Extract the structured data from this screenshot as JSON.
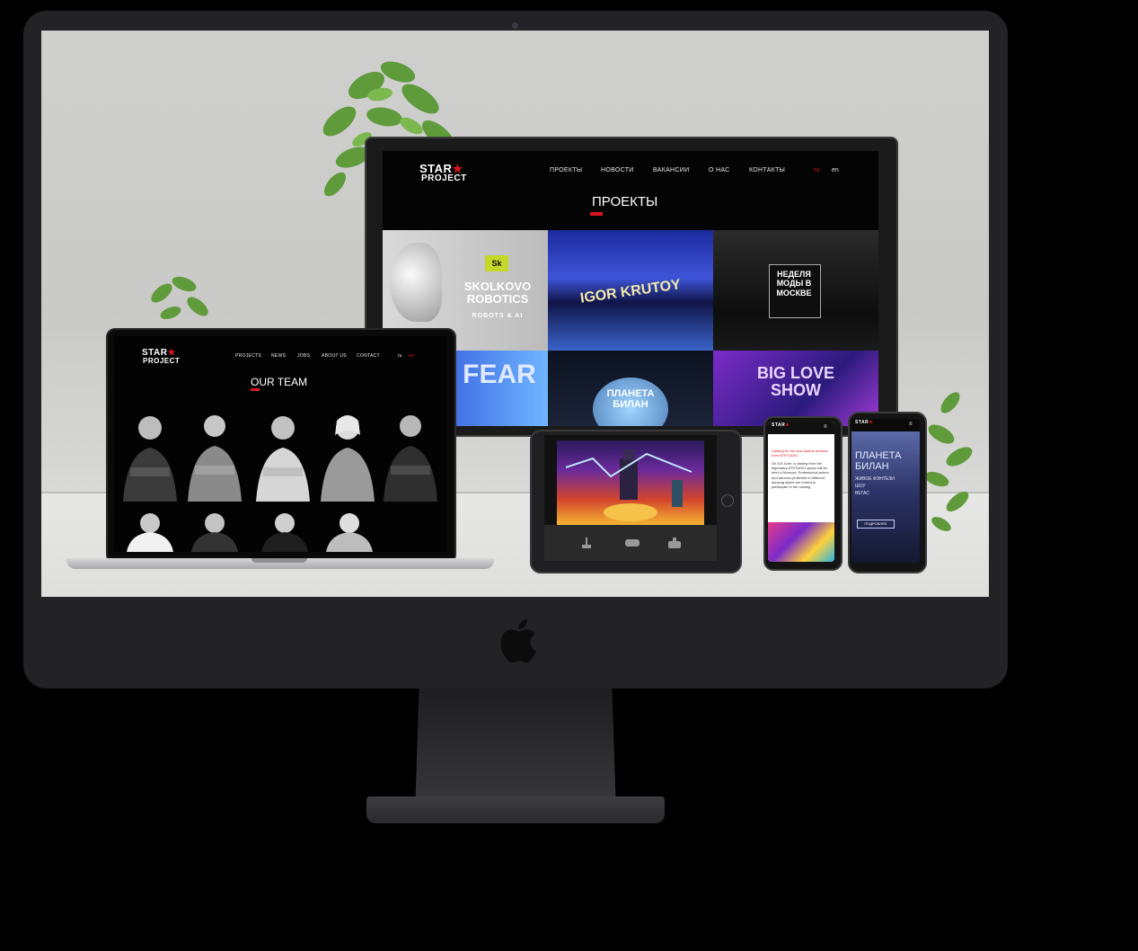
{
  "monitor": {
    "logo_line1": "STAR",
    "logo_line2": "PROJECT",
    "nav": [
      "ПРОЕКТЫ",
      "НОВОСТИ",
      "ВАКАНСИИ",
      "О НАС",
      "КОНТАКТЫ"
    ],
    "lang_ru": "ru",
    "lang_en": "en",
    "page_title": "ПРОЕКТЫ",
    "tiles": [
      {
        "text": "SKOLKOVO ROBOTICS",
        "sub": "ROBOTS & AI",
        "badge": "Sk"
      },
      {
        "text": "IGOR KRUTOY",
        "sub": ""
      },
      {
        "text": "НЕДЕЛЯ МОДЫ В МОСКВЕ",
        "sub": ""
      },
      {
        "text": "FEAR",
        "sub": ""
      },
      {
        "text": "ПЛАНЕТА БИЛАН",
        "sub": ""
      },
      {
        "text": "BIG LOVE SHOW",
        "sub": ""
      }
    ]
  },
  "laptop": {
    "logo_line1": "STAR",
    "logo_line2": "PROJECT",
    "nav": [
      "PROJECTS",
      "NEWS",
      "JOBS",
      "ABOUT US",
      "CONTACT"
    ],
    "lang_ru": "ru",
    "lang_en": "en",
    "page_title": "OUR TEAM"
  },
  "phone1": {
    "heading": "Casting for the new Iutome musical from ATSTUDIO",
    "body": "On 5-9 June, a casting from the legendary ATSTUDIO group will be held in Moscow. Professional actors and dancers proficient in different dancing styles are invited to participate in the casting."
  },
  "phone2": {
    "title": "ПЛАНЕТА БИЛАН",
    "sub1": "ЖИВОЕ ФЭНТЕЗИ",
    "sub2": "ШОУ",
    "sub3": "ВЕГАС",
    "button": "ПОДРОБНЕЕ"
  },
  "colors": {
    "brand_red": "#d9141e",
    "dark": "#040404"
  }
}
